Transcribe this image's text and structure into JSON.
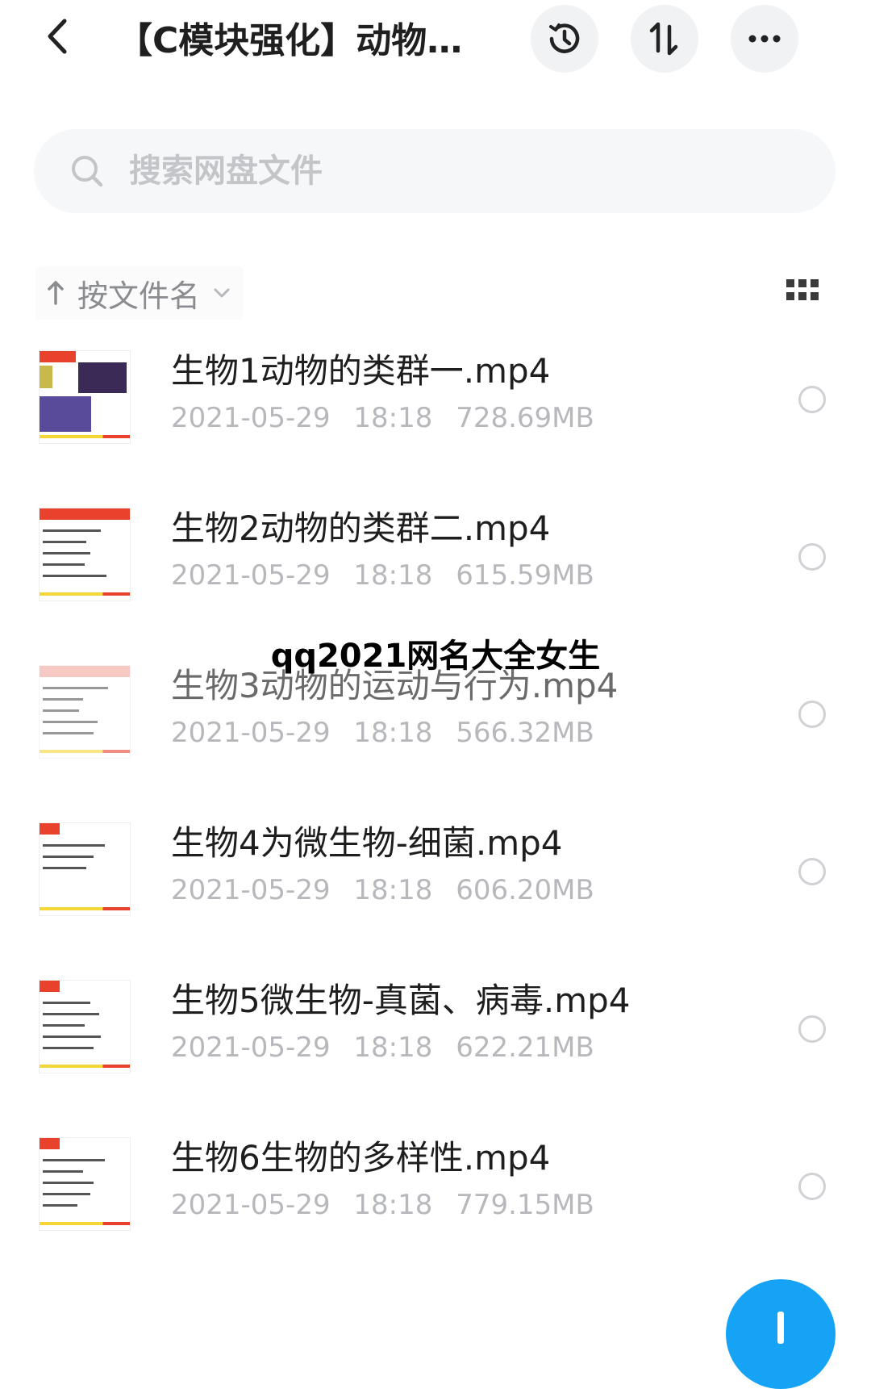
{
  "header": {
    "title": "【C模块强化】动物…",
    "back_icon": "back-arrow-icon",
    "history_icon": "history-icon",
    "sort_icon": "sort-icon",
    "more_icon": "more-icon"
  },
  "search": {
    "placeholder": "搜索网盘文件",
    "icon": "search-icon"
  },
  "sort": {
    "label": "按文件名",
    "icon": "arrow-up-icon",
    "dropdown_icon": "chevron-down-icon",
    "view_icon": "grid-view-icon"
  },
  "watermark": "qq2021网名大全女生",
  "files": [
    {
      "name": "生物1动物的类群一.mp4",
      "date": "2021-05-29",
      "time": "18:18",
      "size": "728.69MB"
    },
    {
      "name": "生物2动物的类群二.mp4",
      "date": "2021-05-29",
      "time": "18:18",
      "size": "615.59MB"
    },
    {
      "name": "生物3动物的运动与行为.mp4",
      "date": "2021-05-29",
      "time": "18:18",
      "size": "566.32MB"
    },
    {
      "name": "生物4为微生物-细菌.mp4",
      "date": "2021-05-29",
      "time": "18:18",
      "size": "606.20MB"
    },
    {
      "name": "生物5微生物-真菌、病毒.mp4",
      "date": "2021-05-29",
      "time": "18:18",
      "size": "622.21MB"
    },
    {
      "name": "生物6生物的多样性.mp4",
      "date": "2021-05-29",
      "time": "18:18",
      "size": "779.15MB"
    }
  ],
  "colors": {
    "accent": "#16a3f5",
    "thumb_header": "#e8412c",
    "thumb_bar": "#f5d637",
    "meta_text": "#b6b8bc"
  }
}
